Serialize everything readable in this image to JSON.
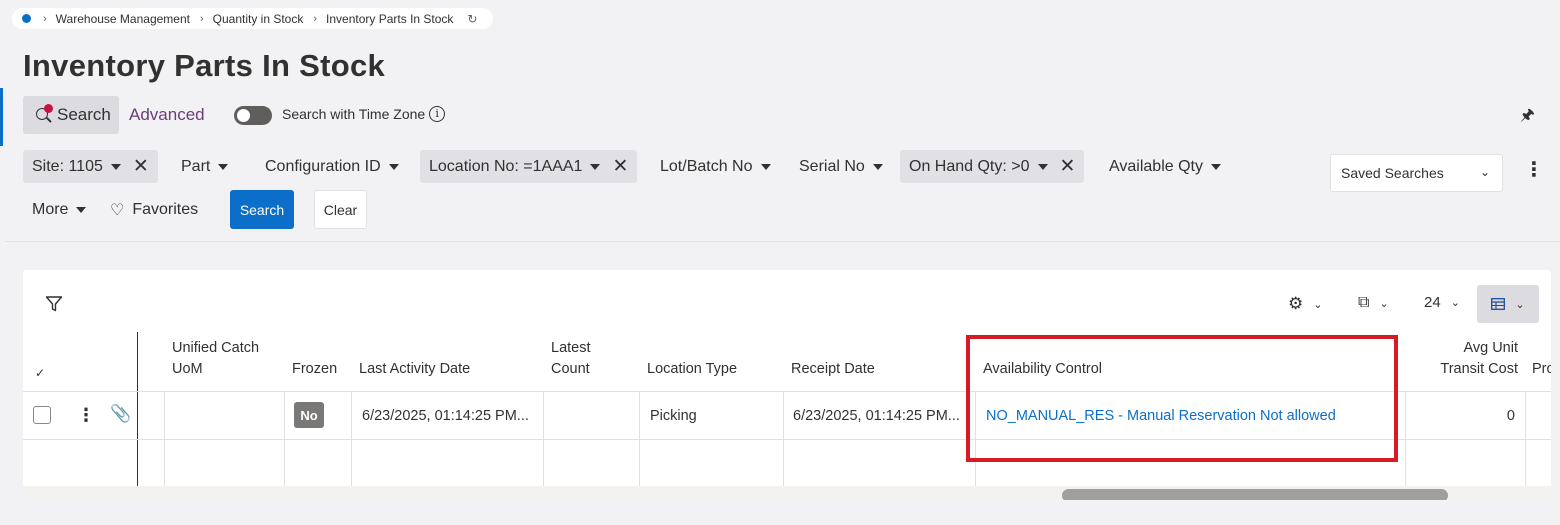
{
  "breadcrumb": {
    "items": [
      "Warehouse Management",
      "Quantity in Stock",
      "Inventory Parts In Stock"
    ]
  },
  "page": {
    "title": "Inventory Parts In Stock"
  },
  "search_modes": {
    "search": "Search",
    "advanced": "Advanced",
    "time_zone_label": "Search with Time Zone",
    "time_zone_enabled": false
  },
  "filters": [
    {
      "label": "Site: 1105",
      "active": true
    },
    {
      "label": "Part",
      "active": false
    },
    {
      "label": "Configuration ID",
      "active": false
    },
    {
      "label": "Location No: =1AAA1",
      "active": true
    },
    {
      "label": "Lot/Batch No",
      "active": false
    },
    {
      "label": "Serial No",
      "active": false
    },
    {
      "label": "On Hand Qty: >0",
      "active": true
    },
    {
      "label": "Available Qty",
      "active": false
    }
  ],
  "actions": {
    "more": "More",
    "favorites": "Favorites",
    "search": "Search",
    "clear": "Clear",
    "saved_searches": "Saved Searches"
  },
  "grid_toolbar": {
    "page_size": "24"
  },
  "grid": {
    "columns": [
      "Unified Catch UoM",
      "Frozen",
      "Last Activity Date",
      "Latest Count",
      "Location Type",
      "Receipt Date",
      "Availability Control",
      "Avg Unit Transit Cost",
      "Pro"
    ],
    "column_lines": {
      "unified_catch_uom": [
        "Unified Catch",
        "UoM"
      ],
      "latest_count": [
        "Latest",
        "Count"
      ],
      "avg_unit_transit_cost": [
        "Avg Unit",
        "Transit Cost"
      ]
    },
    "rows": [
      {
        "unified_catch_uom": "",
        "frozen": "No",
        "last_activity_date": "6/23/2025, 01:14:25 PM...",
        "latest_count": "",
        "location_type": "Picking",
        "receipt_date": "6/23/2025, 01:14:25 PM...",
        "availability_control": "NO_MANUAL_RES - Manual Reservation Not allowed",
        "avg_unit_transit_cost": "0"
      }
    ]
  },
  "colors": {
    "accent": "#0b6fc9",
    "highlight": "#d71b26",
    "advanced": "#6b3e79"
  }
}
